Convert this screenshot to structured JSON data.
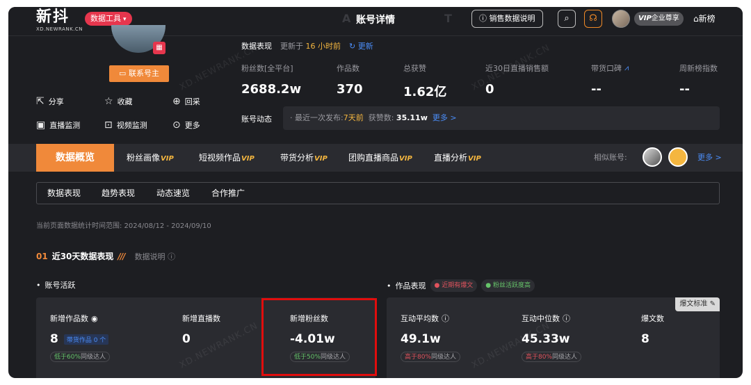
{
  "header": {
    "logo_cn": "新抖",
    "logo_en": "XD.NEWRANK.CN",
    "tool_badge": "数据工具",
    "page_title": "账号详情",
    "sales_btn": "销售数据说明",
    "vip_label": "企业尊享",
    "vip_prefix": "VIP",
    "newrank": "新榜"
  },
  "profile": {
    "contact_btn": "联系号主",
    "actions": [
      "分享",
      "收藏",
      "回采",
      "直播监测",
      "视频监测",
      "更多"
    ]
  },
  "performance": {
    "label": "数据表现",
    "updated_prefix": "更新于",
    "updated_value": "16 小时前",
    "update_link": "更新"
  },
  "stats": [
    {
      "label": "粉丝数[全平台]",
      "value": "2688.2w"
    },
    {
      "label": "作品数",
      "value": "370"
    },
    {
      "label": "总获赞",
      "value": "1.62亿"
    },
    {
      "label": "近30日直播销售额",
      "value": "0"
    },
    {
      "label": "带货口碑",
      "value": "--"
    },
    {
      "label": "周新榜指数",
      "value": "--"
    }
  ],
  "dynamics": {
    "label": "账号动态",
    "last_post_prefix": "· 最近一次发布:",
    "last_post_value": "7天前",
    "likes_prefix": "获赞数:",
    "likes_value": "35.11w",
    "more": "更多 >"
  },
  "tabs": {
    "active": "数据概览",
    "items": [
      {
        "label": "粉丝画像",
        "vip": "VIP"
      },
      {
        "label": "短视频作品",
        "vip": "VIP"
      },
      {
        "label": "带货分析",
        "vip": "VIP"
      },
      {
        "label": "团购直播商品",
        "vip": "VIP"
      },
      {
        "label": "直播分析",
        "vip": "VIP"
      }
    ],
    "similar_label": "相似账号:",
    "more": "更多 >"
  },
  "subtabs": [
    "数据表现",
    "趋势表现",
    "动态速览",
    "合作推广"
  ],
  "range_text": "当前页面数据统计时间范围: 2024/08/12 - 2024/09/10",
  "section": {
    "num": "01",
    "title": "近30天数据表现",
    "explain": "数据说明"
  },
  "account_activity": {
    "title": "账号活跃",
    "metrics": [
      {
        "label": "新增作品数",
        "value": "8",
        "mini": "带货作品 0 个",
        "pill_prefix": "低于60%",
        "pill_suffix": "同级达人"
      },
      {
        "label": "新增直播数",
        "value": "0"
      },
      {
        "label": "新增粉丝数",
        "value": "-4.01w",
        "pill_prefix": "低于50%",
        "pill_suffix": "同级达人"
      }
    ]
  },
  "works_performance": {
    "title": "作品表现",
    "tag1": "近期有爆文",
    "tag2": "粉丝活跃度高",
    "std_tag": "爆文标准",
    "metrics": [
      {
        "label": "互动平均数",
        "value": "49.1w",
        "pill_prefix": "高于80%",
        "pill_suffix": "同级达人"
      },
      {
        "label": "互动中位数",
        "value": "45.33w",
        "pill_prefix": "高于80%",
        "pill_suffix": "同级达人"
      },
      {
        "label": "爆文数",
        "value": "8"
      }
    ]
  },
  "watermark": "XD.NEWRANK.CN",
  "colors": {
    "accent": "#f0893a",
    "brand_red": "#e6364d",
    "link": "#4b8df8",
    "highlight": "#e10d0d"
  }
}
